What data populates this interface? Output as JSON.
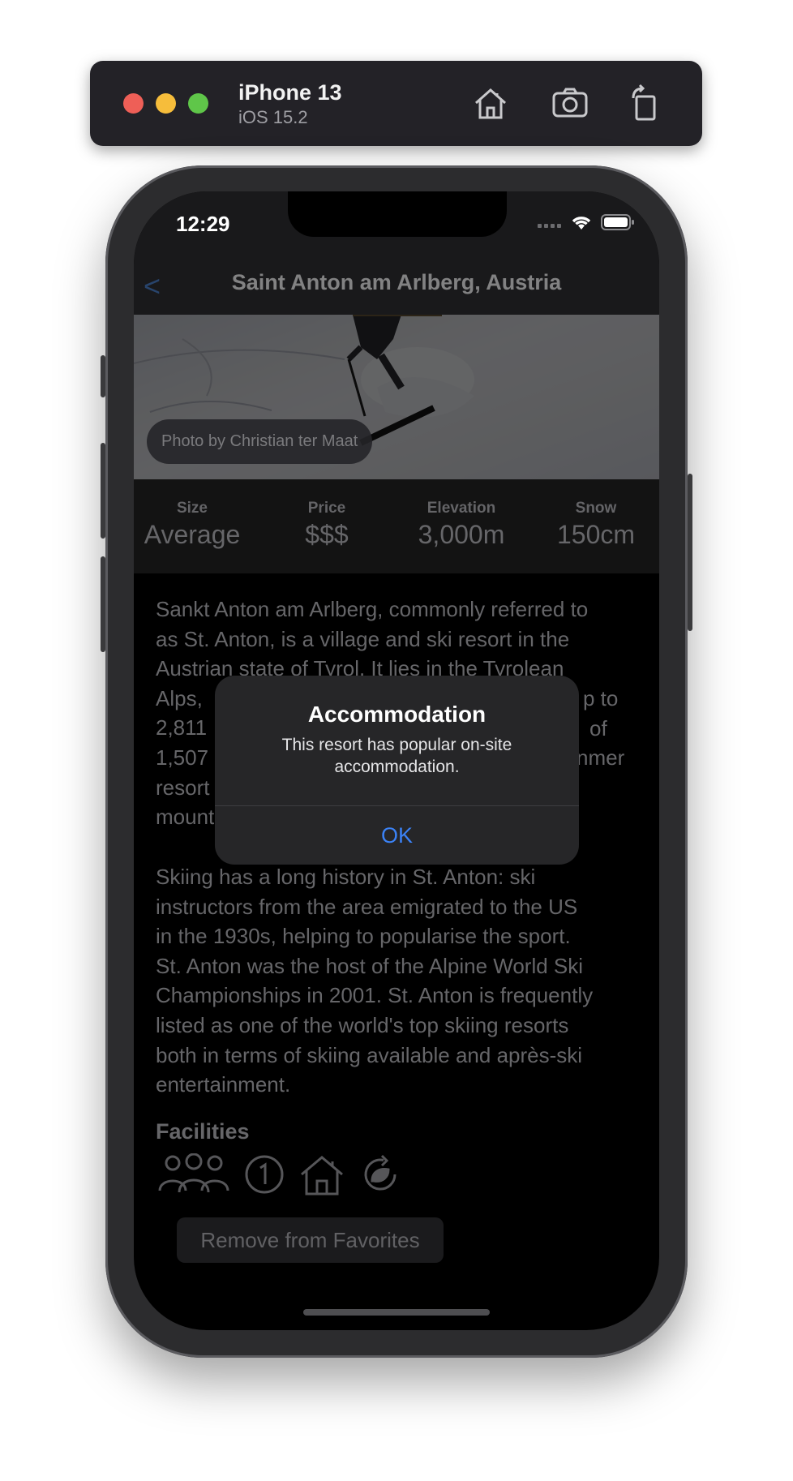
{
  "simulator": {
    "device_name": "iPhone 13",
    "os_version": "iOS 15.2"
  },
  "status_bar": {
    "time": "12:29"
  },
  "navigation": {
    "back_label": "<",
    "title": "Saint Anton am Arlberg, Austria"
  },
  "hero": {
    "photo_credit": "Photo by Christian ter Maat"
  },
  "stats": [
    {
      "label": "Size",
      "value": "Average"
    },
    {
      "label": "Price",
      "value": "$$$"
    },
    {
      "label": "Elevation",
      "value": "3,000m"
    },
    {
      "label": "Snow",
      "value": "150cm"
    }
  ],
  "description": {
    "paragraph1_lines": [
      "Sankt Anton am Arlberg, commonly referred to",
      "as St. Anton, is a village and ski resort in the",
      "Austrian state of Tyrol. It lies in the Tyrolean",
      "Alps, ",
      "2,811",
      "1,507",
      "resort",
      "mount"
    ],
    "paragraph1_right_fragments": [
      "p to",
      "of",
      "nmer"
    ],
    "paragraph2_lines": [
      "Skiing has a long history in St. Anton: ski",
      "instructors from the area emigrated to the US",
      "in the 1930s, helping to popularise the sport.",
      "St. Anton was the host of the Alpine World Ski",
      "Championships in 2001. St. Anton is frequently",
      "listed as one of the world's top skiing resorts",
      "both in terms of skiing available and après-ski",
      "entertainment."
    ]
  },
  "facilities": {
    "title": "Facilities",
    "icons": [
      "family-icon",
      "number-one-icon",
      "house-icon",
      "recycle-leaf-icon"
    ]
  },
  "favorites_button": {
    "label": "Remove from Favorites"
  },
  "alert": {
    "title": "Accommodation",
    "message": "This resort has popular on-site accommodation.",
    "ok_label": "OK"
  },
  "colors": {
    "accent": "#3b82f6",
    "background": "#000000",
    "alert_bg": "#262628"
  }
}
